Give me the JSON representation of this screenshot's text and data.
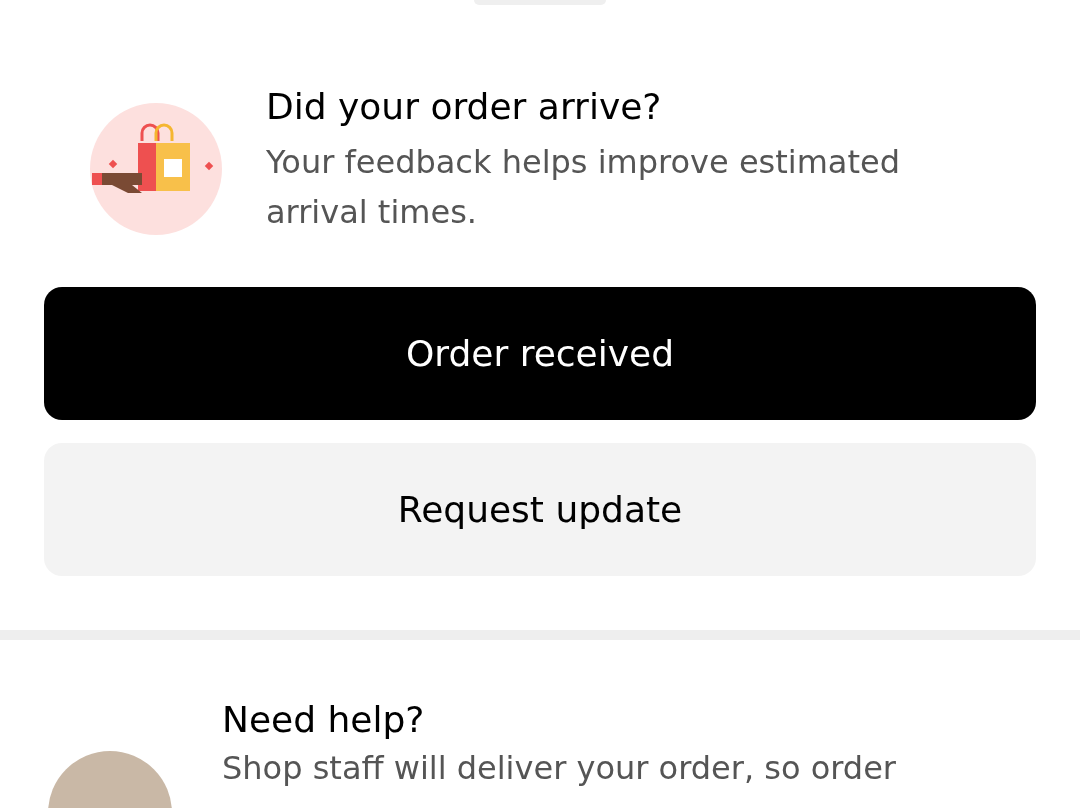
{
  "feedback": {
    "title": "Did your order arrive?",
    "description": "Your feedback helps improve estimated arrival times."
  },
  "buttons": [
    {
      "label": "Order received",
      "kind": "primary"
    },
    {
      "label": "Request update",
      "kind": "secondary"
    }
  ],
  "help": {
    "title": "Need help?",
    "description": "Shop staff will deliver your order, so order"
  }
}
